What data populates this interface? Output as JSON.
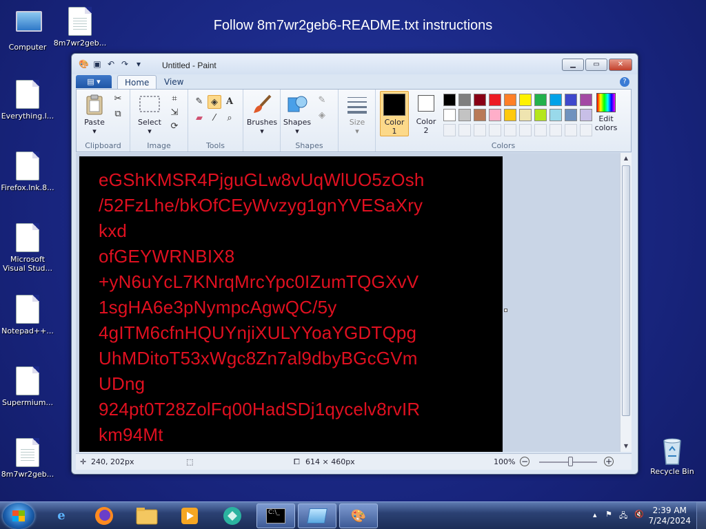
{
  "desktop": {
    "banner": "Follow 8m7wr2geb6-README.txt instructions",
    "icons": [
      {
        "label": "Computer",
        "icon": "computer-icon"
      },
      {
        "label": "8m7wr2geb...",
        "icon": "text-file-icon"
      },
      {
        "label": "Everything.l...",
        "icon": "file-icon"
      },
      {
        "label": "Firefox.lnk.8...",
        "icon": "file-icon"
      },
      {
        "label": "Microsoft Visual Stud...",
        "icon": "file-icon"
      },
      {
        "label": "Notepad++...",
        "icon": "file-icon"
      },
      {
        "label": "Supermium...",
        "icon": "file-icon"
      },
      {
        "label": "8m7wr2geb...",
        "icon": "text-file-icon"
      },
      {
        "label": "Recycle Bin",
        "icon": "recycle-bin-icon"
      }
    ]
  },
  "window": {
    "title": "Untitled - Paint",
    "tabs": [
      {
        "label": "Home",
        "active": true
      },
      {
        "label": "View",
        "active": false
      }
    ],
    "ribbon": {
      "clipboard": {
        "title": "Clipboard",
        "paste": "Paste"
      },
      "image": {
        "title": "Image",
        "select": "Select"
      },
      "tools": {
        "title": "Tools"
      },
      "brushes": "Brushes",
      "shapes": {
        "title": "Shapes",
        "shapes": "Shapes"
      },
      "size": "Size",
      "color1": "Color\n1",
      "color1_a": "Color",
      "color1_b": "1",
      "color2_a": "Color",
      "color2_b": "2",
      "edit_colors_a": "Edit",
      "edit_colors_b": "colors",
      "colors_title": "Colors",
      "palette_row1": [
        "#000000",
        "#7f7f7f",
        "#880015",
        "#ed1c24",
        "#ff7f27",
        "#fff200",
        "#22b14c",
        "#00a2e8",
        "#3f48cc",
        "#a349a4"
      ],
      "palette_row2": [
        "#ffffff",
        "#c3c3c3",
        "#b97a57",
        "#ffaec9",
        "#ffc90e",
        "#efe4b0",
        "#b5e61d",
        "#99d9ea",
        "#7092be",
        "#c8bfe7"
      ]
    },
    "canvas_lines": [
      "eGShKMSR4PjguGLw8vUqWlUO5zOsh",
      "/52FzLhe/bkOfCEyWvzyg1gnYVESaXry",
      "kxd",
      "ofGEYWRNBIX8",
      "+yN6uYcL7KNrqMrcYpc0IZumTQGXvV",
      "1sgHA6e3pNympcAgwQC/5y",
      "4gITM6cfnHQUYnjiXULYYoaYGDTQpg",
      "UhMDitoT53xWgc8Zn7al9dbyBGcGVm",
      "UDng",
      "924pt0T28ZolFq00HadSDj1qycelv8rvIR",
      "km94Mt"
    ],
    "status": {
      "cursor": "240, 202px",
      "size": "614 × 460px",
      "zoom": "100%"
    }
  },
  "taskbar": {
    "time": "2:39 AM",
    "date": "7/24/2024"
  }
}
